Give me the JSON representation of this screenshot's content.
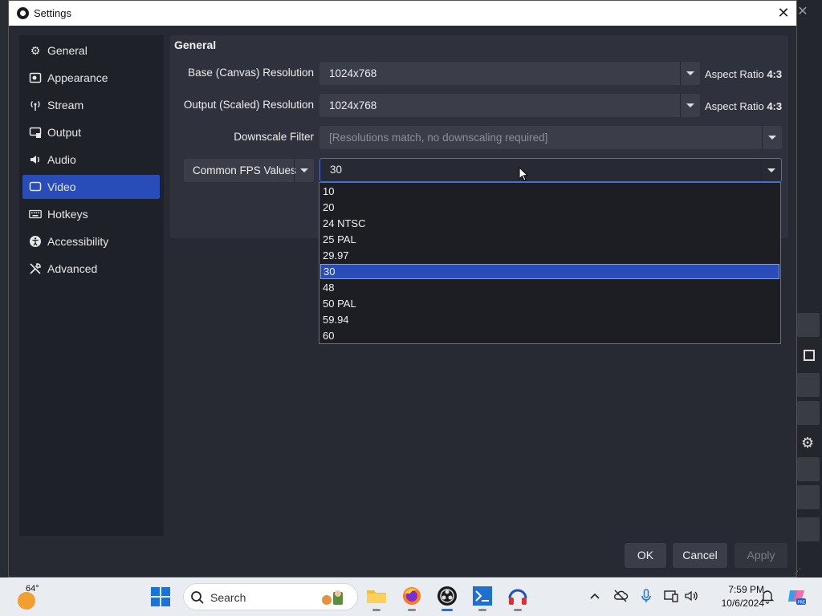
{
  "window": {
    "title": "Settings",
    "close_label": "✕"
  },
  "sidebar": {
    "items": [
      {
        "label": "General",
        "icon": "gear-icon"
      },
      {
        "label": "Appearance",
        "icon": "appearance-icon"
      },
      {
        "label": "Stream",
        "icon": "antenna-icon"
      },
      {
        "label": "Output",
        "icon": "output-icon"
      },
      {
        "label": "Audio",
        "icon": "speaker-icon"
      },
      {
        "label": "Video",
        "icon": "monitor-icon",
        "active": true
      },
      {
        "label": "Hotkeys",
        "icon": "keyboard-icon"
      },
      {
        "label": "Accessibility",
        "icon": "accessibility-icon"
      },
      {
        "label": "Advanced",
        "icon": "wrench-icon"
      }
    ]
  },
  "video": {
    "section_title": "General",
    "base_resolution": {
      "label": "Base (Canvas) Resolution",
      "value": "1024x768",
      "aspect_prefix": "Aspect Ratio",
      "aspect_value": "4:3"
    },
    "output_resolution": {
      "label": "Output (Scaled) Resolution",
      "value": "1024x768",
      "aspect_prefix": "Aspect Ratio",
      "aspect_value": "4:3"
    },
    "downscale_filter": {
      "label": "Downscale Filter",
      "value": "[Resolutions match, no downscaling required]"
    },
    "fps_type": {
      "value": "Common FPS Values"
    },
    "fps_value": {
      "value": "30"
    },
    "fps_options": [
      "10",
      "20",
      "24 NTSC",
      "25 PAL",
      "29.97",
      "30",
      "48",
      "50 PAL",
      "59.94",
      "60"
    ],
    "fps_selected_index": 5
  },
  "buttons": {
    "ok": "OK",
    "cancel": "Cancel",
    "apply": "Apply"
  },
  "taskbar": {
    "weather_temp": "64°",
    "search_label": "Search",
    "time": "7:59 PM",
    "date": "10/6/2024",
    "apps": [
      "file-explorer-icon",
      "firefox-icon",
      "obs-icon",
      "vscode-icon",
      "headphones-app-icon"
    ],
    "colors": {
      "accent": "#284cb8",
      "windows_blue": "#1a73d9"
    }
  }
}
